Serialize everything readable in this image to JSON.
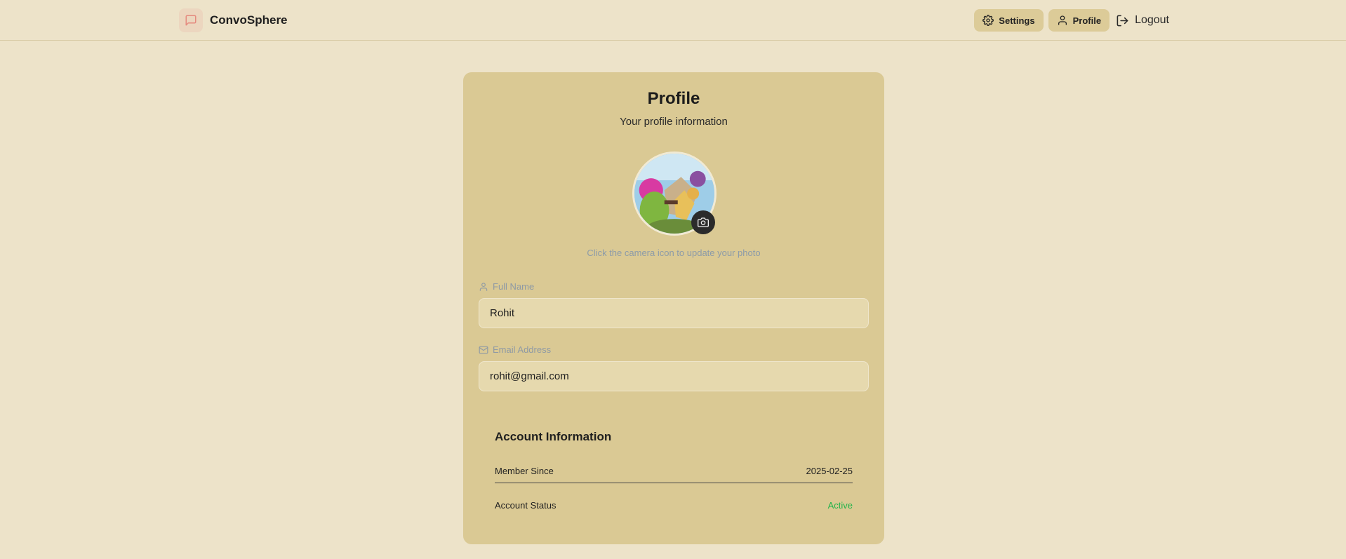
{
  "header": {
    "brand_name": "ConvoSphere",
    "brand_icon": "message-square-icon",
    "nav": {
      "settings_label": "Settings",
      "profile_label": "Profile",
      "logout_label": "Logout"
    }
  },
  "profile": {
    "title": "Profile",
    "subtitle": "Your profile information",
    "photo_hint": "Click the camera icon to update your photo",
    "full_name_label": "Full Name",
    "full_name_value": "Rohit",
    "email_label": "Email Address",
    "email_value": "rohit@gmail.com"
  },
  "account": {
    "title": "Account Information",
    "rows": [
      {
        "label": "Member Since",
        "value": "2025-02-25"
      },
      {
        "label": "Account Status",
        "value": "Active"
      }
    ]
  },
  "colors": {
    "page_bg": "#ede3c9",
    "card_bg": "#dac994",
    "nav_btn_bg": "#dccb98",
    "active_status": "#22b34a",
    "brand_icon_color": "#e58a7f"
  }
}
